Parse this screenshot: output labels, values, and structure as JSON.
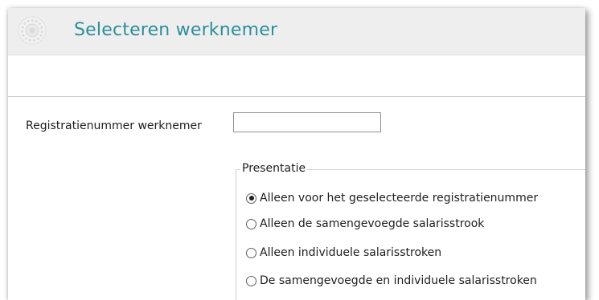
{
  "window": {
    "title": "Selecteren werknemer"
  },
  "form": {
    "registration_label": "Registratienummer werknemer",
    "registration_value": ""
  },
  "presentation": {
    "legend": "Presentatie",
    "options": [
      {
        "label": "Alleen voor het geselecteerde registratienummer",
        "selected": true
      },
      {
        "label": "Alleen de samengevoegde salarisstrook",
        "selected": false
      },
      {
        "label": "Alleen individuele salarisstroken",
        "selected": false
      },
      {
        "label": "De samengevoegde en individuele salarisstroken",
        "selected": false
      }
    ]
  },
  "icons": {
    "app_logo": "gear-seal-logo-icon"
  },
  "colors": {
    "title_text": "#2b8f9a",
    "titlebar_bg": "#eeeeee"
  }
}
